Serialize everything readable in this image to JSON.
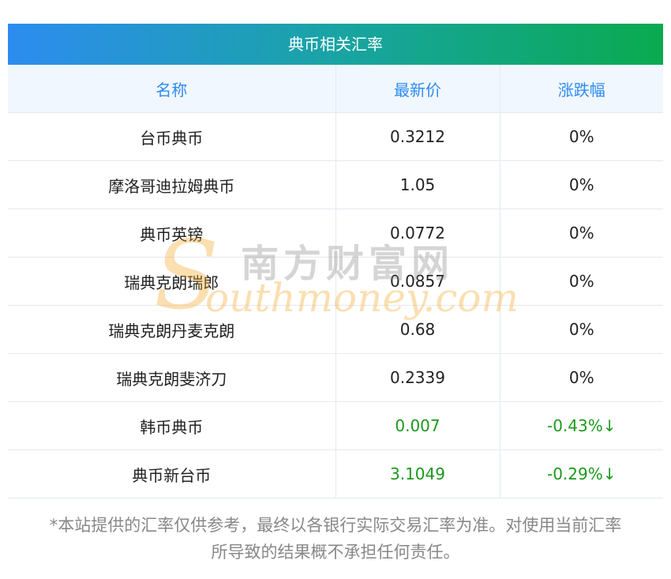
{
  "table": {
    "title": "典币相关汇率",
    "headers": [
      "名称",
      "最新价",
      "涨跌幅"
    ],
    "rows": [
      {
        "name": "台币典币",
        "price": "0.3212",
        "change": "0%",
        "trend": "flat"
      },
      {
        "name": "摩洛哥迪拉姆典币",
        "price": "1.05",
        "change": "0%",
        "trend": "flat"
      },
      {
        "name": "典币英镑",
        "price": "0.0772",
        "change": "0%",
        "trend": "flat"
      },
      {
        "name": "瑞典克朗瑞郎",
        "price": "0.0857",
        "change": "0%",
        "trend": "flat"
      },
      {
        "name": "瑞典克朗丹麦克朗",
        "price": "0.68",
        "change": "0%",
        "trend": "flat"
      },
      {
        "name": "瑞典克朗斐济刀",
        "price": "0.2339",
        "change": "0%",
        "trend": "flat"
      },
      {
        "name": "韩币典币",
        "price": "0.007",
        "change": "-0.43%↓",
        "trend": "down"
      },
      {
        "name": "典币新台币",
        "price": "3.1049",
        "change": "-0.29%↓",
        "trend": "down"
      }
    ]
  },
  "watermark": {
    "letter": "S",
    "cn": "南方财富网",
    "en": "outhmoney.com"
  },
  "footnote": {
    "line1": "*本站提供的汇率仅供参考，最终以各银行实际交易汇率为准。对使用当前汇率",
    "line2": "所导致的结果概不承担任何责任。"
  },
  "colors": {
    "header_text": "#2d8cf0",
    "down": "#1b9a1b",
    "gradient_start": "#2d8cf0",
    "gradient_end": "#0aaa50"
  }
}
